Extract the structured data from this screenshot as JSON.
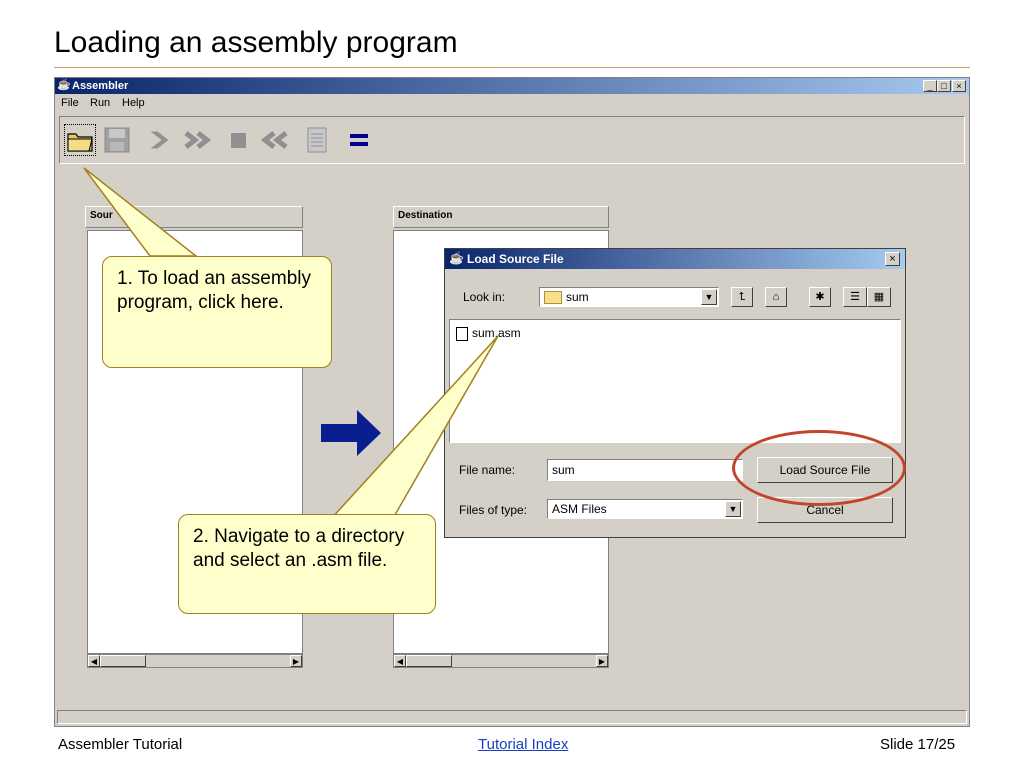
{
  "slide": {
    "title": "Loading an assembly program"
  },
  "window": {
    "title": "Assembler",
    "controls": [
      "_",
      "□",
      "×"
    ],
    "menu": [
      "File",
      "Run",
      "Help"
    ],
    "toolbar_icons": [
      "open-icon",
      "save-icon",
      "step-icon",
      "run-icon",
      "stop-icon",
      "back-icon",
      "listing-icon",
      "equals-icon"
    ]
  },
  "panels": {
    "source_label": "Sour",
    "destination_label": "Destination"
  },
  "dialog": {
    "title": "Load Source File",
    "look_in_label": "Look in:",
    "look_in_value": "sum",
    "files": [
      "sum.asm"
    ],
    "file_name_label": "File name:",
    "file_name_value": "sum",
    "files_of_type_label": "Files of type:",
    "files_of_type_value": "ASM Files",
    "load_button": "Load Source File",
    "cancel_button": "Cancel"
  },
  "callouts": {
    "one": "1. To load an assembly program, click here.",
    "two": "2. Navigate to a directory and select an .asm file."
  },
  "footer": {
    "left": "Assembler Tutorial",
    "center": "Tutorial Index",
    "right": "Slide 17/25"
  },
  "colors": {
    "titlebar_start": "#0a246a",
    "titlebar_end": "#a6caf0",
    "callout_fill": "#ffffcc",
    "highlight": "#c0452b",
    "arrow": "#0a1f8f"
  }
}
